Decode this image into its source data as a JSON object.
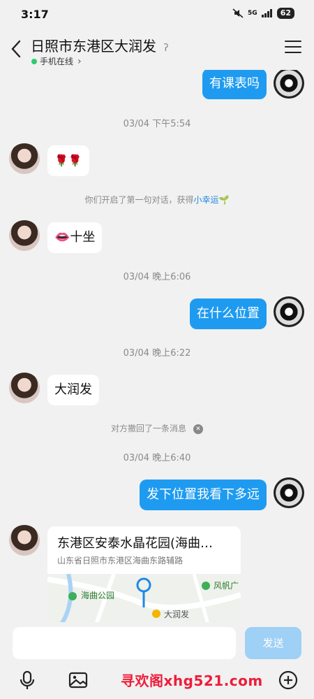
{
  "status": {
    "time": "3:17",
    "network": "5G",
    "battery": "62"
  },
  "header": {
    "title": "日照市东港区大润发",
    "subtitle": "手机在线",
    "subtitle_arrow": "›"
  },
  "messages": {
    "m1": "有课表吗",
    "t1": "03/04 下午5:54",
    "m2": "🌹🌹",
    "sys1_prefix": "你们开启了第一句对话，获得",
    "sys1_link": "小幸运",
    "sys1_emoji": "🌱",
    "m3": "👄十坐",
    "t2": "03/04 晚上6:06",
    "m4": "在什么位置",
    "t3": "03/04 晚上6:22",
    "m5": "大润发",
    "sys2": "对方撤回了一条消息",
    "t4": "03/04 晚上6:40",
    "m6": "发下位置我看下多远"
  },
  "location": {
    "title": "东港区安泰水晶花园(海曲…",
    "address": "山东省日照市东港区海曲东路辅路",
    "map_labels": {
      "park": "海曲公园",
      "store": "大润发",
      "fengfan": "风帆广"
    }
  },
  "input": {
    "placeholder": "",
    "send_label": "发送"
  },
  "watermark": "寻欢阁xhg521.com",
  "colors": {
    "bubble_me": "#1e9bf0",
    "send_disabled": "#9fd0f5",
    "online": "#2ecc71"
  }
}
